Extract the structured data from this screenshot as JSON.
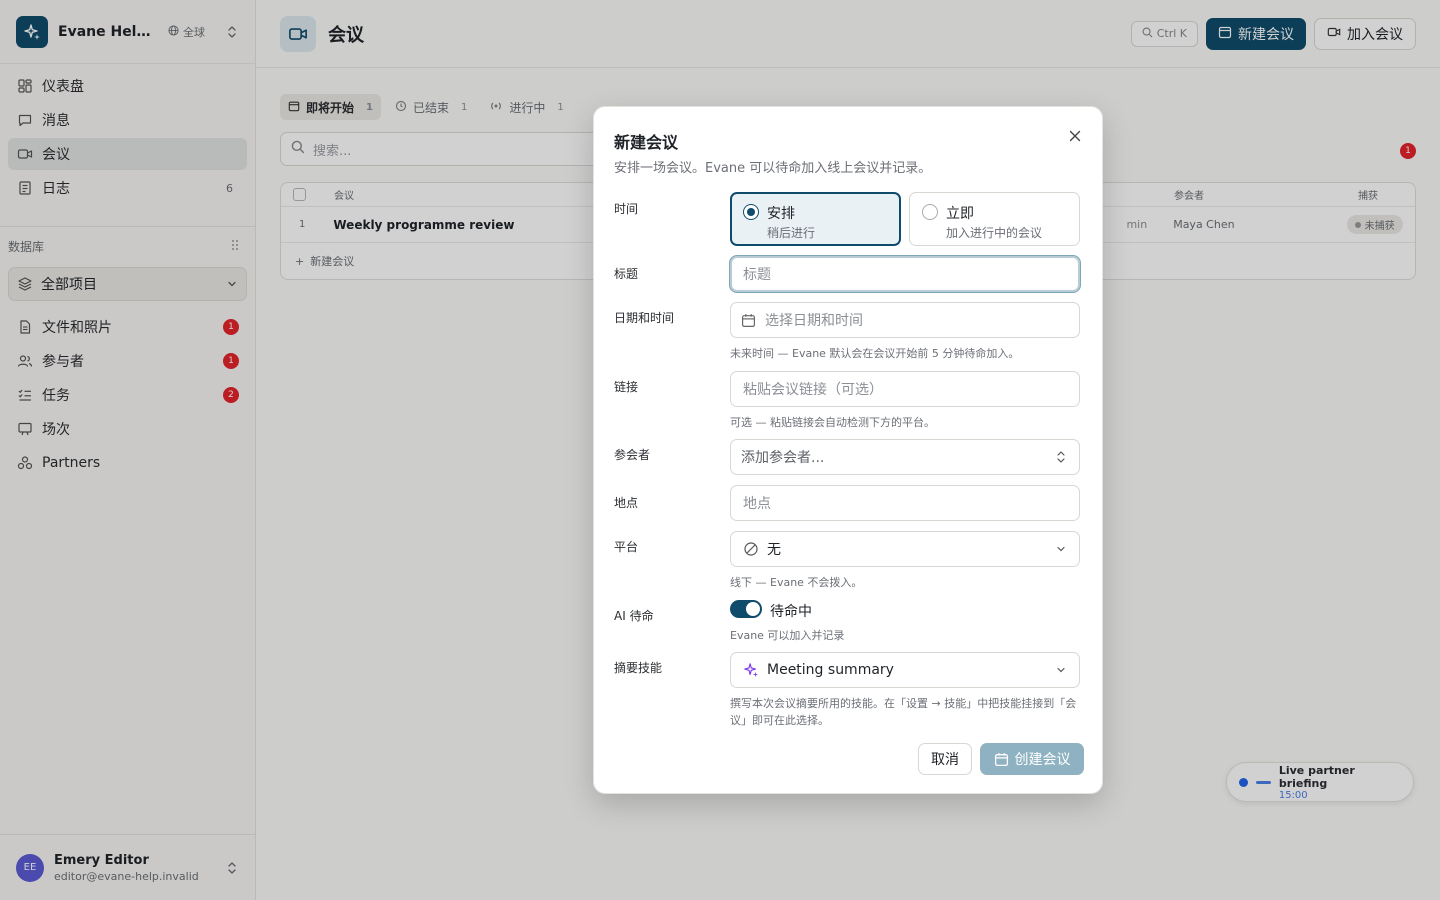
{
  "workspace": {
    "name": "Evane Help Center",
    "scope": "全球"
  },
  "nav": [
    {
      "label": "仪表盘",
      "icon": "dashboard-icon"
    },
    {
      "label": "消息",
      "icon": "message-icon"
    },
    {
      "label": "会议",
      "icon": "video-icon",
      "active": true
    },
    {
      "label": "日志",
      "icon": "log-icon",
      "count": "6"
    }
  ],
  "database": {
    "heading": "数据库",
    "selector": "全部项目",
    "items": [
      {
        "label": "文件和照片",
        "badge": "1"
      },
      {
        "label": "参与者",
        "badge": "1"
      },
      {
        "label": "任务",
        "badge": "2"
      },
      {
        "label": "场次"
      },
      {
        "label": "Partners"
      }
    ]
  },
  "user": {
    "initials": "EE",
    "name": "Emery Editor",
    "email": "editor@evane-help.invalid"
  },
  "page": {
    "title": "会议",
    "shortcut": "Ctrl K",
    "new_meeting": "新建会议",
    "join_meeting": "加入会议",
    "tabs": [
      {
        "label": "即将开始",
        "count": "1"
      },
      {
        "label": "已结束",
        "count": "1"
      },
      {
        "label": "进行中",
        "count": "1"
      }
    ],
    "search_placeholder": "搜索...",
    "filter_badge": "1",
    "columns": {
      "meeting": "会议",
      "attendees": "参会者",
      "recording": "捕获"
    },
    "rows": [
      {
        "index": "1",
        "title": "Weekly programme review",
        "duration": "min",
        "attendee": "Maya Chen",
        "status": "未捕获"
      }
    ],
    "add_row": "新建会议"
  },
  "live": {
    "title": "Live partner briefing",
    "time": "15:00"
  },
  "modal": {
    "title": "新建会议",
    "subtitle": "安排一场会议。Evane 可以待命加入线上会议并记录。",
    "time_label": "时间",
    "options": [
      {
        "label": "安排",
        "sub": "稍后进行",
        "selected": true
      },
      {
        "label": "立即",
        "sub": "加入进行中的会议",
        "selected": false
      }
    ],
    "title_label": "标题",
    "title_placeholder": "标题",
    "datetime_label": "日期和时间",
    "datetime_placeholder": "选择日期和时间",
    "datetime_hint": "未来时间 — Evane 默认会在会议开始前 5 分钟待命加入。",
    "link_label": "链接",
    "link_placeholder": "粘贴会议链接（可选）",
    "link_hint": "可选 — 粘贴链接会自动检测下方的平台。",
    "attendees_label": "参会者",
    "attendees_placeholder": "添加参会者...",
    "location_label": "地点",
    "location_placeholder": "地点",
    "platform_label": "平台",
    "platform_value": "无",
    "platform_hint": "线下 — Evane 不会拨入。",
    "ai_label": "AI 待命",
    "ai_value": "待命中",
    "ai_on": true,
    "ai_hint": "Evane 可以加入并记录",
    "skill_label": "摘要技能",
    "skill_value": "Meeting summary",
    "skill_hint_1": "撰写本次会议摘要所用的技能。在「设置 → 技能」中把技能挂接到「会",
    "skill_hint_2": "议」即可在此选择。",
    "cancel": "取消",
    "create": "创建会议"
  }
}
